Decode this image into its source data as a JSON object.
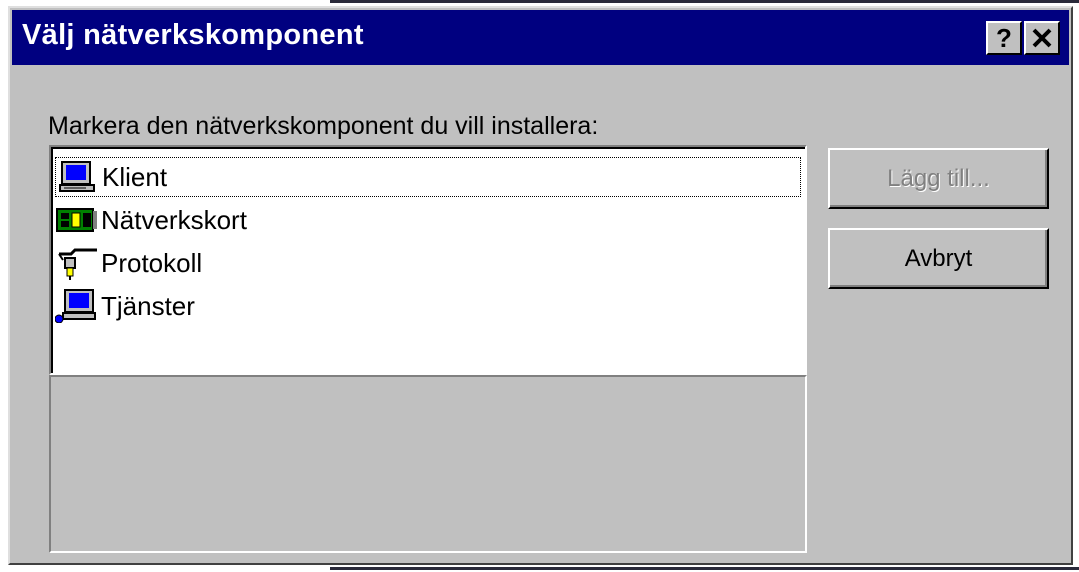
{
  "dialog": {
    "title": "Välj nätverkskomponent",
    "help_label": "?",
    "close_label": "✕"
  },
  "prompt": "Markera den nätverkskomponent du vill installera:",
  "list": {
    "items": [
      {
        "label": "Klient",
        "icon": "client-computer-icon",
        "focused": true
      },
      {
        "label": "Nätverkskort",
        "icon": "network-card-icon",
        "focused": false
      },
      {
        "label": "Protokoll",
        "icon": "protocol-cable-icon",
        "focused": false
      },
      {
        "label": "Tjänster",
        "icon": "service-computer-icon",
        "focused": false
      }
    ]
  },
  "buttons": {
    "add_label": "Lägg till...",
    "cancel_label": "Avbryt"
  },
  "colors": {
    "titlebar": "#000080",
    "face": "#c0c0c0",
    "disabled_text": "#808080"
  }
}
